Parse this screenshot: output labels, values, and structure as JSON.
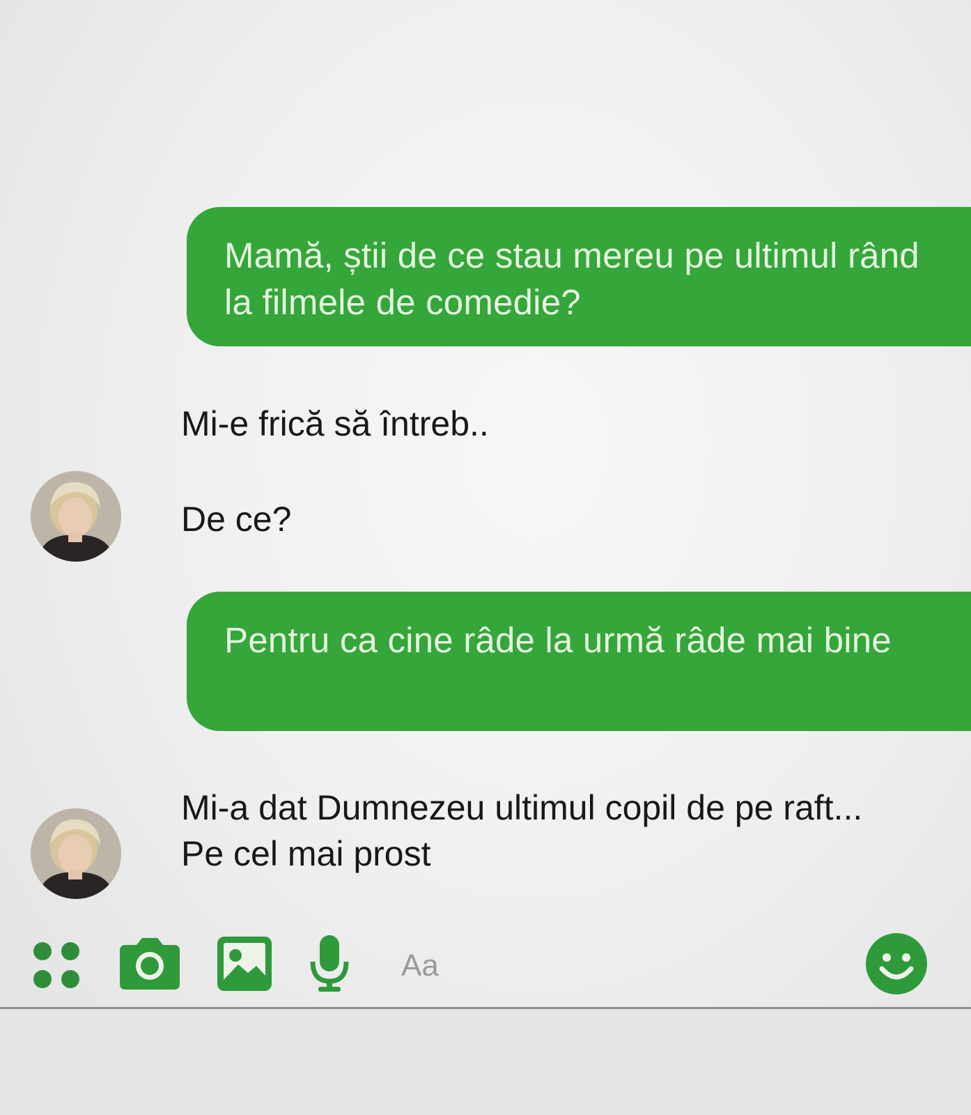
{
  "messages": [
    {
      "direction": "outgoing",
      "text": "Mamă, știi de ce stau mereu pe ultimul rând la filmele de comedie?"
    },
    {
      "direction": "incoming",
      "text": "Mi-e frică să întreb.."
    },
    {
      "direction": "incoming",
      "text": "De ce?"
    },
    {
      "direction": "outgoing",
      "text": "Pentru ca cine râde la urmă râde mai bine"
    },
    {
      "direction": "incoming",
      "text": "Mi-a dat Dumnezeu ultimul copil de pe raft... Pe cel mai prost"
    }
  ],
  "composer": {
    "placeholder": "Aa",
    "icons": [
      "apps-icon",
      "camera-icon",
      "image-icon",
      "microphone-icon",
      "emoji-icon"
    ]
  },
  "colors": {
    "accent": "#34a63a",
    "outgoing_text": "#e6f5df",
    "incoming_text": "#181818",
    "background": "#f0f0f0"
  }
}
